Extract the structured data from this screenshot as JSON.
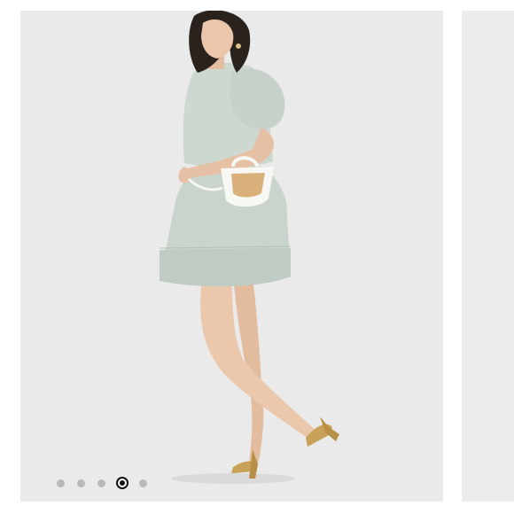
{
  "carousel": {
    "slide_count": 5,
    "active_index": 3,
    "image": {
      "subject": "model-in-sage-tiered-mini-dress",
      "accent_colors": {
        "background": "#eaeaea",
        "dress": "#c9d4cc",
        "hair": "#2a221d",
        "skin": "#e8c3a8",
        "bag_straw": "#d9b07a",
        "bag_trim": "#f7f7f4",
        "heels": "#c9a25a"
      }
    },
    "dot_colors": {
      "inactive": "#b9b9b9",
      "active_ring": "#111111"
    }
  }
}
